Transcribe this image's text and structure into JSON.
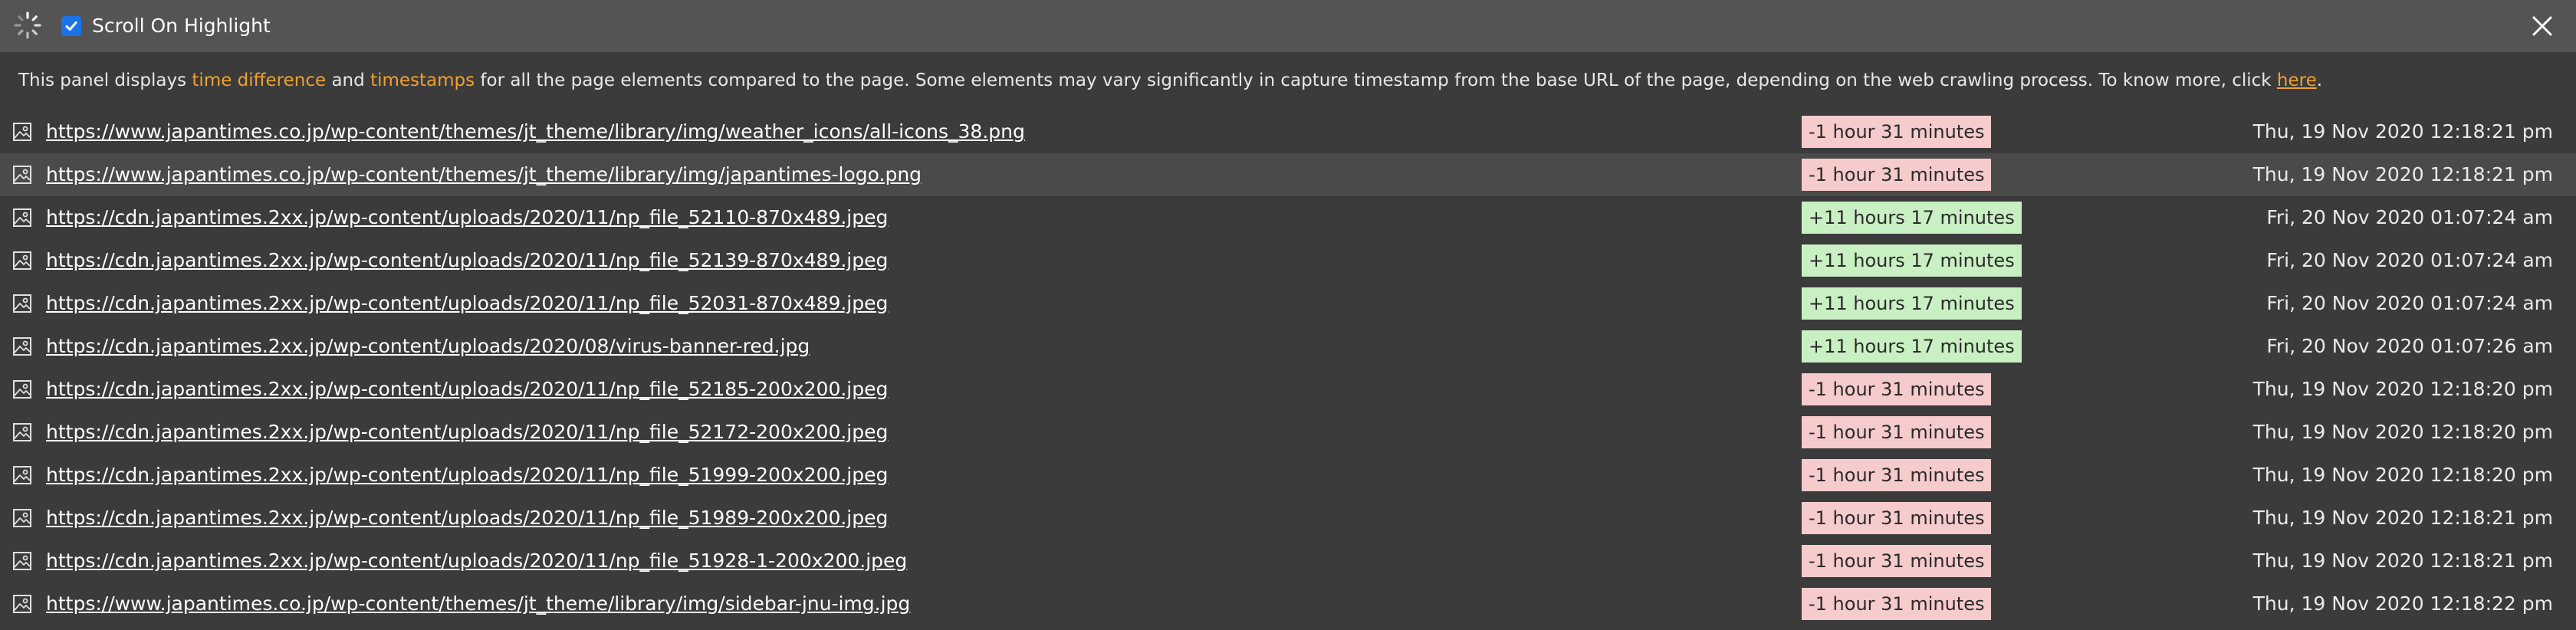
{
  "toolbar": {
    "scroll_label": "Scroll On Highlight",
    "scroll_checked": true
  },
  "info": {
    "part1": "This panel displays ",
    "time_diff": "time difference",
    "part2": " and ",
    "timestamps": "timestamps",
    "part3": " for all the page elements compared to the page. Some elements may vary significantly in capture timestamp from the base URL of the page, depending on the web crawling process. To know more, click ",
    "here": "here",
    "part4": "."
  },
  "rows": [
    {
      "url": "https://www.japantimes.co.jp/wp-content/themes/jt_theme/library/img/weather_icons/all-icons_38.png",
      "diff": "-1 hour 31 minutes",
      "diff_type": "neg",
      "timestamp": "Thu, 19 Nov 2020 12:18:21 pm",
      "highlighted": false
    },
    {
      "url": "https://www.japantimes.co.jp/wp-content/themes/jt_theme/library/img/japantimes-logo.png",
      "diff": "-1 hour 31 minutes",
      "diff_type": "neg",
      "timestamp": "Thu, 19 Nov 2020 12:18:21 pm",
      "highlighted": true
    },
    {
      "url": "https://cdn.japantimes.2xx.jp/wp-content/uploads/2020/11/np_file_52110-870x489.jpeg",
      "diff": "+11 hours 17 minutes",
      "diff_type": "pos",
      "timestamp": "Fri, 20 Nov 2020 01:07:24 am",
      "highlighted": false
    },
    {
      "url": "https://cdn.japantimes.2xx.jp/wp-content/uploads/2020/11/np_file_52139-870x489.jpeg",
      "diff": "+11 hours 17 minutes",
      "diff_type": "pos",
      "timestamp": "Fri, 20 Nov 2020 01:07:24 am",
      "highlighted": false
    },
    {
      "url": "https://cdn.japantimes.2xx.jp/wp-content/uploads/2020/11/np_file_52031-870x489.jpeg",
      "diff": "+11 hours 17 minutes",
      "diff_type": "pos",
      "timestamp": "Fri, 20 Nov 2020 01:07:24 am",
      "highlighted": false
    },
    {
      "url": "https://cdn.japantimes.2xx.jp/wp-content/uploads/2020/08/virus-banner-red.jpg",
      "diff": "+11 hours 17 minutes",
      "diff_type": "pos",
      "timestamp": "Fri, 20 Nov 2020 01:07:26 am",
      "highlighted": false
    },
    {
      "url": "https://cdn.japantimes.2xx.jp/wp-content/uploads/2020/11/np_file_52185-200x200.jpeg",
      "diff": "-1 hour 31 minutes",
      "diff_type": "neg",
      "timestamp": "Thu, 19 Nov 2020 12:18:20 pm",
      "highlighted": false
    },
    {
      "url": "https://cdn.japantimes.2xx.jp/wp-content/uploads/2020/11/np_file_52172-200x200.jpeg",
      "diff": "-1 hour 31 minutes",
      "diff_type": "neg",
      "timestamp": "Thu, 19 Nov 2020 12:18:20 pm",
      "highlighted": false
    },
    {
      "url": "https://cdn.japantimes.2xx.jp/wp-content/uploads/2020/11/np_file_51999-200x200.jpeg",
      "diff": "-1 hour 31 minutes",
      "diff_type": "neg",
      "timestamp": "Thu, 19 Nov 2020 12:18:20 pm",
      "highlighted": false
    },
    {
      "url": "https://cdn.japantimes.2xx.jp/wp-content/uploads/2020/11/np_file_51989-200x200.jpeg",
      "diff": "-1 hour 31 minutes",
      "diff_type": "neg",
      "timestamp": "Thu, 19 Nov 2020 12:18:21 pm",
      "highlighted": false
    },
    {
      "url": "https://cdn.japantimes.2xx.jp/wp-content/uploads/2020/11/np_file_51928-1-200x200.jpeg",
      "diff": "-1 hour 31 minutes",
      "diff_type": "neg",
      "timestamp": "Thu, 19 Nov 2020 12:18:21 pm",
      "highlighted": false
    },
    {
      "url": "https://www.japantimes.co.jp/wp-content/themes/jt_theme/library/img/sidebar-jnu-img.jpg",
      "diff": "-1 hour 31 minutes",
      "diff_type": "neg",
      "timestamp": "Thu, 19 Nov 2020 12:18:22 pm",
      "highlighted": false
    }
  ]
}
